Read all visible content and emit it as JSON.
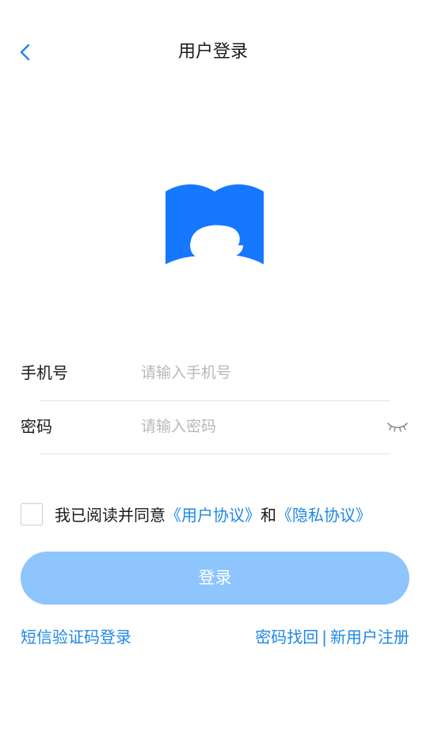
{
  "header": {
    "title": "用户登录",
    "back_icon": "chevron-left-icon"
  },
  "logo": {
    "icon": "book-c-logo",
    "color": "#1677ff"
  },
  "form": {
    "phone": {
      "label": "手机号",
      "value": "",
      "placeholder": "请输入手机号"
    },
    "password": {
      "label": "密码",
      "value": "",
      "placeholder": "请输入密码",
      "toggle_icon": "eye-closed-icon"
    }
  },
  "agreement": {
    "checked": false,
    "prefix": "我已阅读并同意",
    "user_agreement": "《用户协议》",
    "conjunction": "和",
    "privacy_agreement": "《隐私协议》"
  },
  "login_button": {
    "label": "登录",
    "color": "#8ec5fc"
  },
  "links": {
    "sms_login": "短信验证码登录",
    "recover_password": "密码找回",
    "separator": "|",
    "register": "新用户注册"
  },
  "colors": {
    "accent": "#1e88e5",
    "placeholder": "#b8b8b8",
    "divider": "#e3e3e3"
  }
}
